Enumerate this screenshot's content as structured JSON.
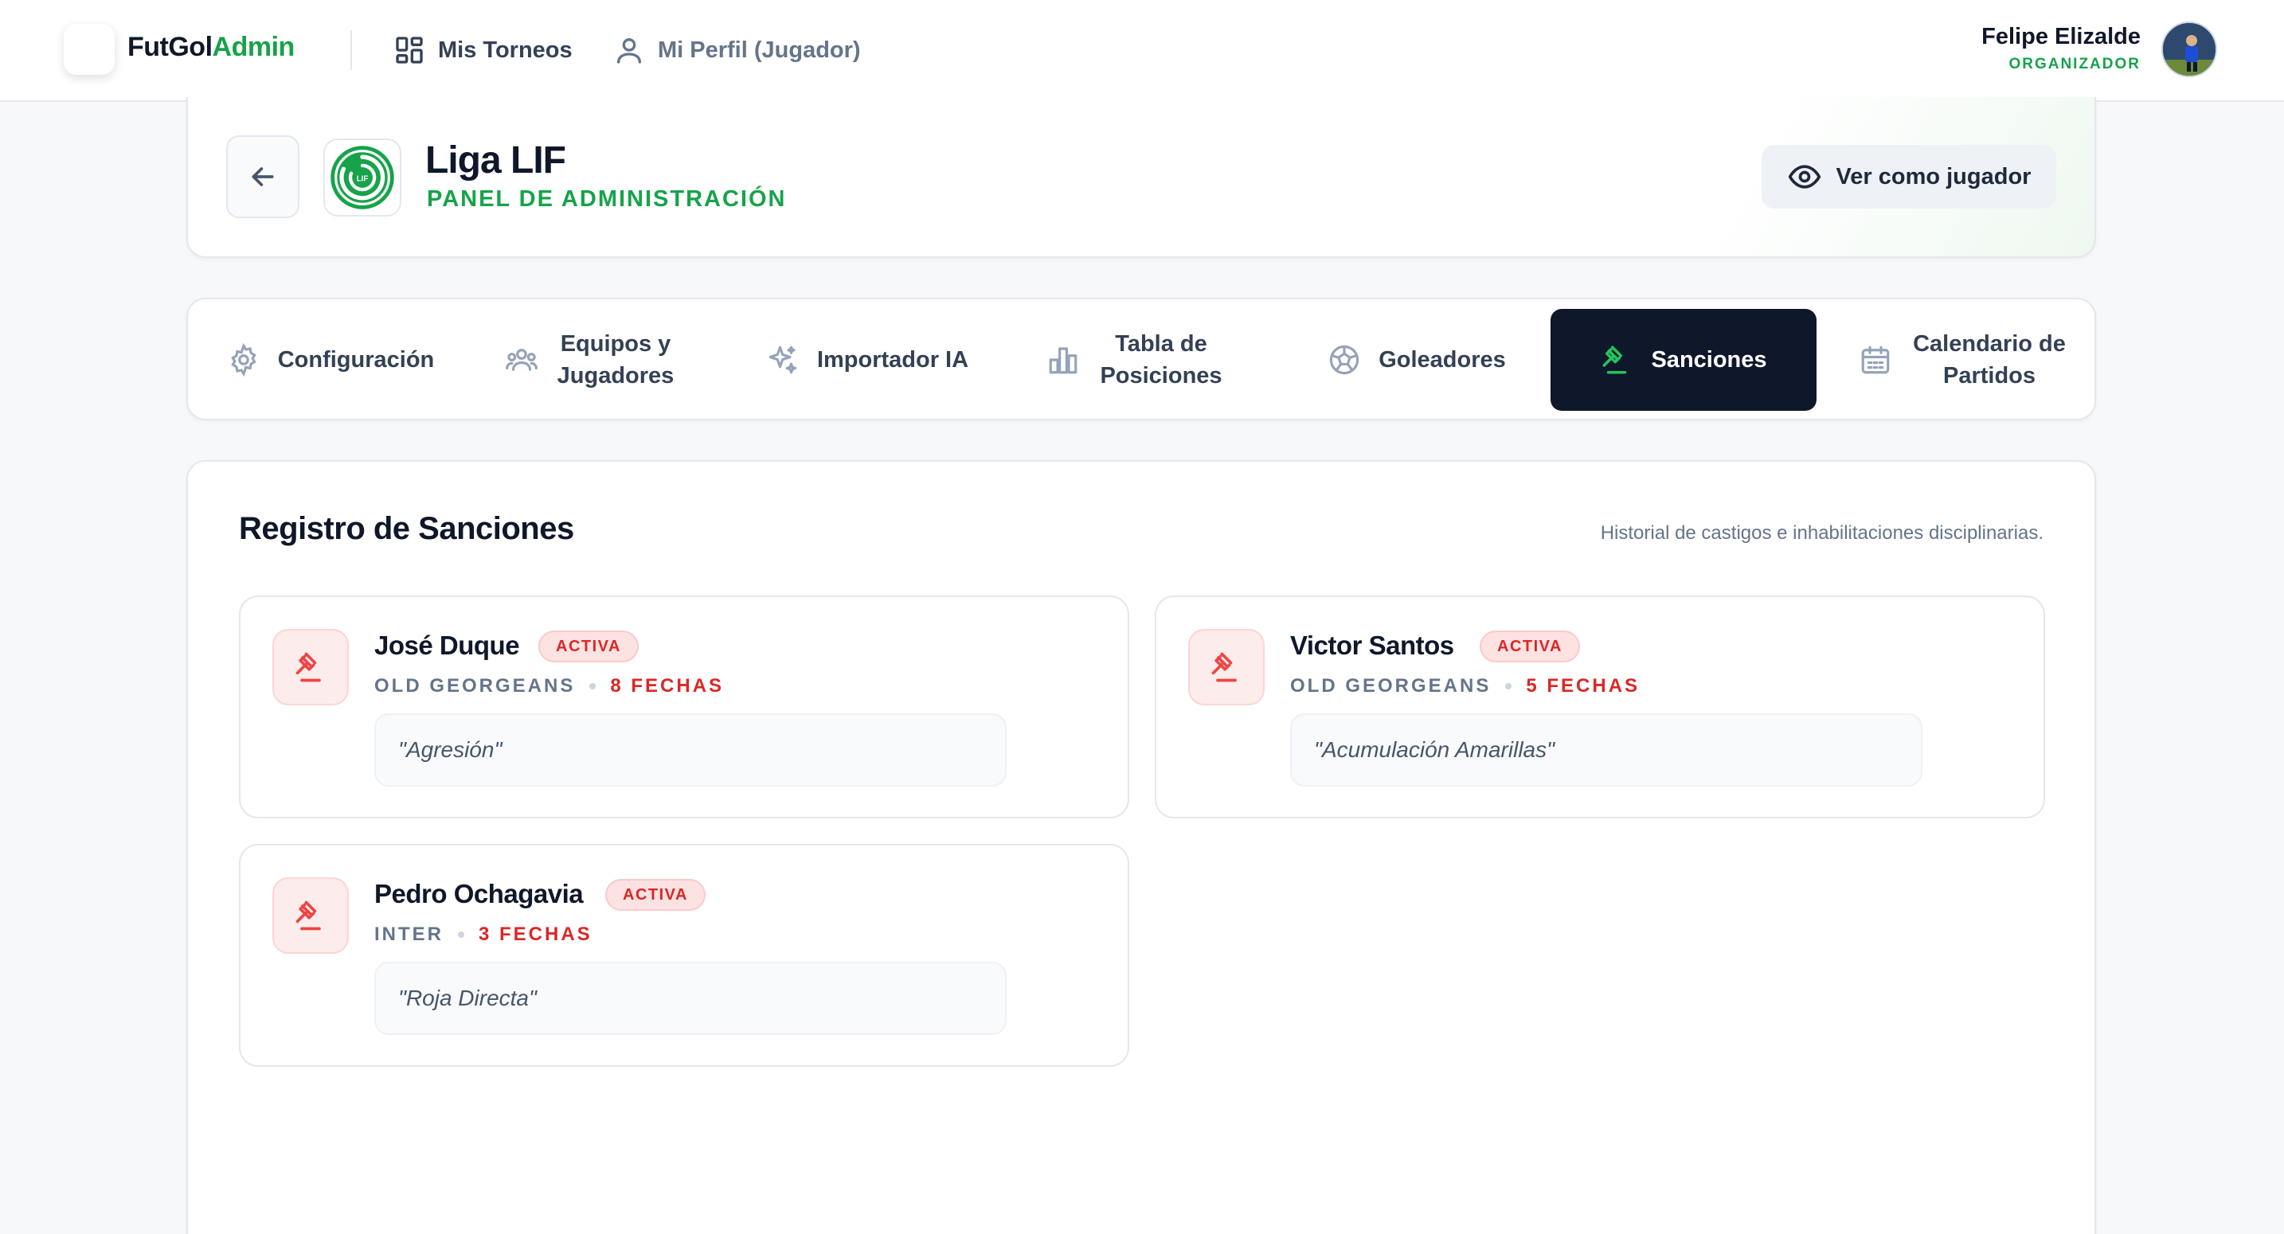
{
  "topbar": {
    "brand_main": "FutGol",
    "brand_accent": "Admin",
    "nav": [
      {
        "label": "Mis Torneos",
        "icon": "dashboard-grid-icon"
      },
      {
        "label": "Mi Perfil (Jugador)",
        "icon": "user-icon"
      }
    ],
    "user": {
      "name": "Felipe Elizalde",
      "role": "ORGANIZADOR"
    }
  },
  "league": {
    "title": "Liga LIF",
    "subtitle": "PANEL DE ADMINISTRACIÓN",
    "logo_text": "LIF",
    "view_button": "Ver como jugador"
  },
  "tabs": [
    {
      "label": "Configuración",
      "icon": "gear-icon",
      "active": false
    },
    {
      "label": "Equipos y Jugadores",
      "icon": "users-group-icon",
      "active": false
    },
    {
      "label": "Importador IA",
      "icon": "sparkles-icon",
      "active": false
    },
    {
      "label": "Tabla de Posiciones",
      "icon": "bar-chart-icon",
      "active": false
    },
    {
      "label": "Goleadores",
      "icon": "soccer-ball-icon",
      "active": false
    },
    {
      "label": "Sanciones",
      "icon": "gavel-icon",
      "active": true
    },
    {
      "label": "Calendario de Partidos",
      "icon": "calendar-icon",
      "active": false
    }
  ],
  "section": {
    "title": "Registro de Sanciones",
    "description": "Historial de castigos e inhabilitaciones disciplinarias."
  },
  "sanctions": [
    {
      "player": "José Duque",
      "status": "ACTIVA",
      "team": "OLD GEORGEANS",
      "dates": "8 FECHAS",
      "reason": "\"Agresión\""
    },
    {
      "player": "Victor Santos",
      "status": "ACTIVA",
      "team": "OLD GEORGEANS",
      "dates": "5 FECHAS",
      "reason": "\"Acumulación Amarillas\""
    },
    {
      "player": "Pedro Ochagavia",
      "status": "ACTIVA",
      "team": "INTER",
      "dates": "3 FECHAS",
      "reason": "\"Roja Directa\""
    }
  ],
  "colors": {
    "accent_green": "#16a34a",
    "danger_red": "#dc2626",
    "active_tab_bg": "#0f172a"
  }
}
